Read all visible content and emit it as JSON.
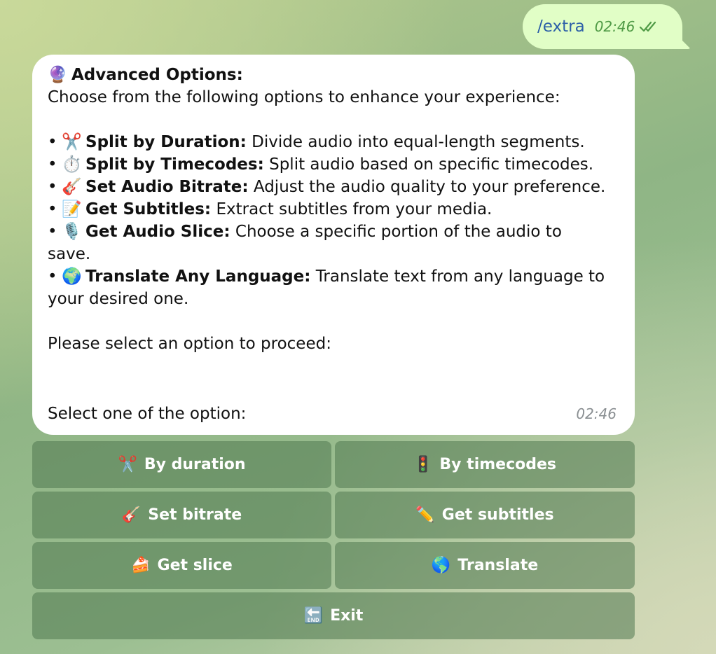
{
  "outgoing": {
    "text": "/extra",
    "time": "02:46"
  },
  "incoming": {
    "title_emoji": "🔮",
    "title": "Advanced Options:",
    "intro": "Choose from the following options to enhance your experience:",
    "items": [
      {
        "emoji": "✂️",
        "label": "Split by Duration:",
        "desc": " Divide audio into equal-length segments."
      },
      {
        "emoji": "⏱️",
        "label": "Split by Timecodes:",
        "desc": " Split audio based on specific timecodes."
      },
      {
        "emoji": "🎸",
        "label": "Set Audio Bitrate:",
        "desc": " Adjust the audio quality to your preference."
      },
      {
        "emoji": "📝",
        "label": "Get Subtitles:",
        "desc": " Extract subtitles from your media."
      },
      {
        "emoji": "🎙️",
        "label": "Get Audio Slice:",
        "desc": " Choose a specific portion of the audio to",
        "cont": "save."
      },
      {
        "emoji": "🌍",
        "label": "Translate Any Language:",
        "desc": " Translate text from any language to",
        "cont": "your desired one."
      }
    ],
    "bullet": "•",
    "prompt": "Please select an option to proceed:",
    "select": "Select one of the option:",
    "time": "02:46"
  },
  "keyboard": {
    "by_duration": {
      "emoji": "✂️",
      "label": "By duration"
    },
    "by_timecodes": {
      "emoji": "🚦",
      "label": "By timecodes"
    },
    "set_bitrate": {
      "emoji": "🎸",
      "label": "Set bitrate"
    },
    "get_subtitles": {
      "emoji": "✏️",
      "label": "Get subtitles"
    },
    "get_slice": {
      "emoji": "🍰",
      "label": "Get slice"
    },
    "translate": {
      "emoji": "🌎",
      "label": "Translate"
    },
    "exit": {
      "emoji": "🔚",
      "label": "Exit"
    }
  },
  "colors": {
    "outgoing_bubble": "#e1fec6",
    "outgoing_text": "#2c5fa8",
    "read_ticks": "#4f9a45",
    "keyboard_button": "#5a7f5a"
  }
}
